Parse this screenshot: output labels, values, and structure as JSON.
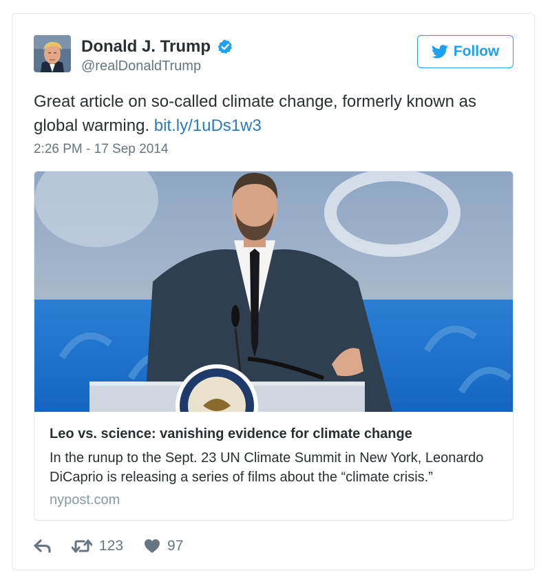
{
  "tweet": {
    "display_name": "Donald J. Trump",
    "handle": "@realDonaldTrump",
    "follow_label": "Follow",
    "text": "Great article on so-called climate change, formerly known as global warming. ",
    "link_text": "bit.ly/1uDs1w3",
    "timestamp": "2:26 PM - 17 Sep 2014"
  },
  "card": {
    "title": "Leo vs. science: vanishing evidence for climate change",
    "description": "In the runup to the Sept. 23 UN Climate Summit in New York, Leonardo DiCaprio is releasing a series of films about the “climate crisis.”",
    "domain": "nypost.com"
  },
  "actions": {
    "retweet_count": "123",
    "like_count": "97"
  },
  "icons": {
    "verified": "verified-badge-icon",
    "follow": "twitter-bird-icon",
    "reply": "reply-arrow-icon",
    "retweet": "retweet-icon",
    "like": "heart-icon"
  },
  "colors": {
    "accent": "#1da1f2",
    "link": "#2b7bb9",
    "text": "#292f33",
    "muted": "#66757f",
    "border": "#e1e8ed"
  }
}
